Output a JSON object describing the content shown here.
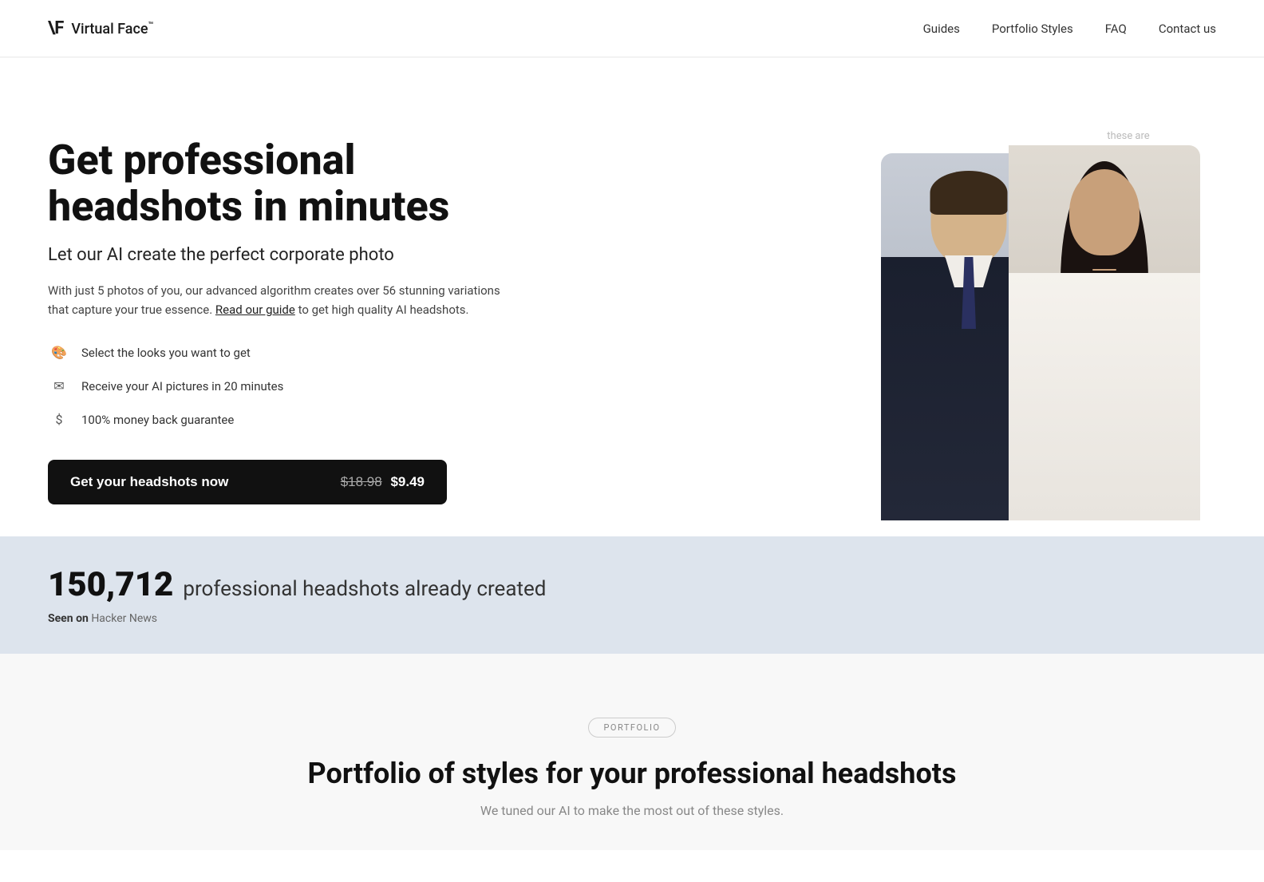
{
  "logo": {
    "mark": "\\F",
    "name": "Virtual Face",
    "tm": "™"
  },
  "nav": {
    "links": [
      {
        "id": "guides",
        "label": "Guides"
      },
      {
        "id": "portfolio-styles",
        "label": "Portfolio Styles"
      },
      {
        "id": "faq",
        "label": "FAQ"
      },
      {
        "id": "contact",
        "label": "Contact us"
      }
    ]
  },
  "hero": {
    "heading_line1": "Get professional",
    "heading_line2": "headshots in minutes",
    "subheading": "Let our AI create the perfect corporate photo",
    "description_pre": "With just 5 photos of you, our advanced algorithm creates over 56 stunning variations that capture your true essence.",
    "description_link": "Read our guide",
    "description_post": " to get high quality AI headshots.",
    "features": [
      {
        "icon": "🎨",
        "text": "Select the looks you want to get"
      },
      {
        "icon": "✉",
        "text": "Receive your AI pictures in 20 minutes"
      },
      {
        "icon": "$",
        "text": "100% money back guarantee"
      }
    ],
    "cta_label": "Get your headshots now",
    "price_old": "$18.98",
    "price_new": "$9.49",
    "annotation": "these are\nvirtual faces"
  },
  "stats": {
    "number": "150,712",
    "text": "professional headshots already created",
    "seen_on_label": "Seen on",
    "seen_on_source": "Hacker News"
  },
  "portfolio": {
    "badge": "PORTFOLIO",
    "heading": "Portfolio of styles for your professional headshots",
    "subheading": "We tuned our AI to make the most out of these styles."
  }
}
